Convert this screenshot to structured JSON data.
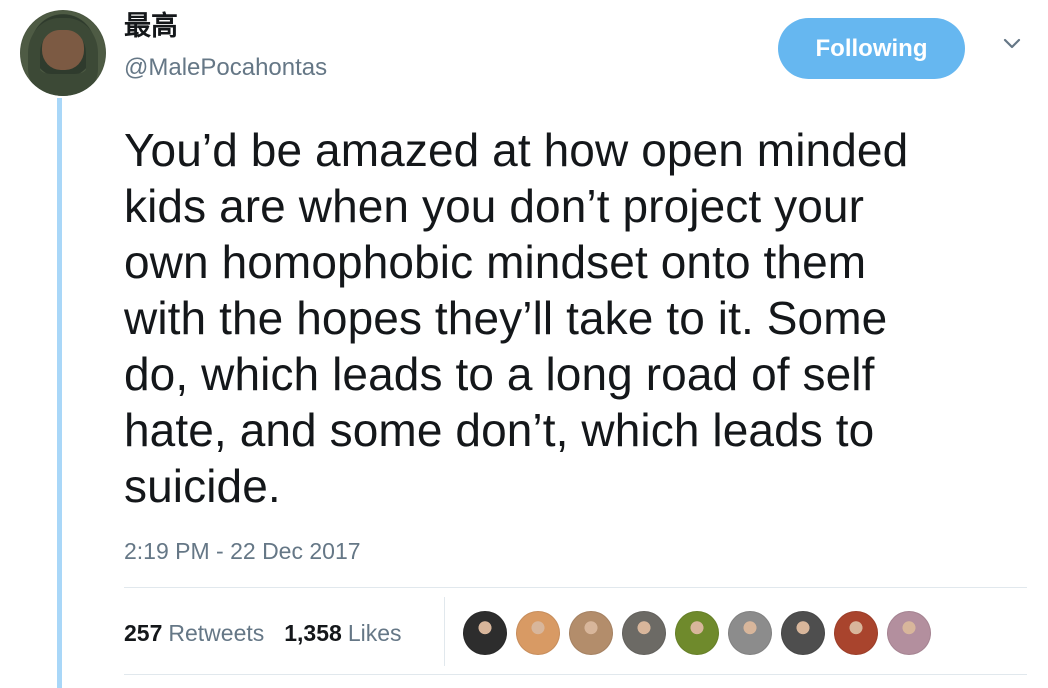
{
  "author": {
    "display_name": "最高",
    "handle": "@MalePocahontas",
    "avatar_icon": "profile-avatar"
  },
  "follow_button": {
    "label": "Following",
    "color": "#66b7f0"
  },
  "menu": {
    "icon": "chevron-down-icon"
  },
  "tweet": {
    "text": "You’d be amazed at how open minded\nkids are when you don’t project your\nown homophobic mindset onto them\nwith the hopes they’ll take to it. Some\ndo, which leads to a long road of self\nhate, and some don’t, which leads to\nsuicide.",
    "timestamp": "2:19 PM - 22 Dec 2017"
  },
  "stats": {
    "retweets_count": "257",
    "retweets_label": "Retweets",
    "likes_count": "1,358",
    "likes_label": "Likes"
  },
  "likers": [
    {
      "name": "liker-avatar-1",
      "color": "#2d2d2d"
    },
    {
      "name": "liker-avatar-2",
      "color": "#d89a64"
    },
    {
      "name": "liker-avatar-3",
      "color": "#b38d6b"
    },
    {
      "name": "liker-avatar-4",
      "color": "#6c6a65"
    },
    {
      "name": "liker-avatar-5",
      "color": "#6f8a2c"
    },
    {
      "name": "liker-avatar-6",
      "color": "#8c8c8c"
    },
    {
      "name": "liker-avatar-7",
      "color": "#4e4e4e"
    },
    {
      "name": "liker-avatar-8",
      "color": "#a9442d"
    },
    {
      "name": "liker-avatar-9",
      "color": "#b38f9e"
    }
  ],
  "colors": {
    "text": "#14171a",
    "muted": "#657786",
    "thread_line": "#a9d7f8",
    "divider": "#e1e8ed"
  }
}
